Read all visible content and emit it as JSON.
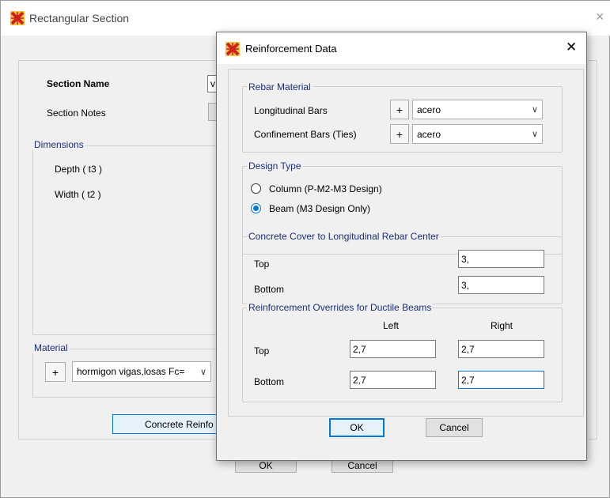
{
  "back_window": {
    "title": "Rectangular Section",
    "close_glyph": "×",
    "section_name_label": "Section Name",
    "section_name_value": "v",
    "section_notes_label": "Section Notes",
    "dimensions": {
      "title": "Dimensions",
      "depth_label": "Depth  ( t3 )",
      "width_label": "Width  ( t2 )"
    },
    "material": {
      "title": "Material",
      "plus": "+",
      "value": "hormigon vigas,losas Fc=",
      "chevron": "∨"
    },
    "concrete_reinf_button": "Concrete Reinfo",
    "ok_button": "OK",
    "cancel_button": "Cancel"
  },
  "dialog": {
    "title": "Reinforcement Data",
    "close_glyph": "✕",
    "rebar_material": {
      "title": "Rebar Material",
      "longitudinal_label": "Longitudinal Bars",
      "longitudinal_value": "acero",
      "confinement_label": "Confinement Bars  (Ties)",
      "confinement_value": "acero",
      "plus": "+",
      "chevron": "∨"
    },
    "design_type": {
      "title": "Design Type",
      "column_label": "Column  (P-M2-M3 Design)",
      "beam_label": "Beam  (M3 Design Only)",
      "selected": "beam"
    },
    "cover": {
      "title": "Concrete Cover to Longitudinal Rebar Center",
      "top_label": "Top",
      "top_value": "3,",
      "bottom_label": "Bottom",
      "bottom_value": "3,"
    },
    "overrides": {
      "title": "Reinforcement Overrides for Ductile Beams",
      "left_header": "Left",
      "right_header": "Right",
      "top_label": "Top",
      "top_left": "2,7",
      "top_right": "2,7",
      "bottom_label": "Bottom",
      "bottom_left": "2,7",
      "bottom_right": "2,7"
    },
    "ok_button": "OK",
    "cancel_button": "Cancel"
  },
  "colors": {
    "accent": "#0078d7",
    "group_title": "#1a2f7a"
  }
}
